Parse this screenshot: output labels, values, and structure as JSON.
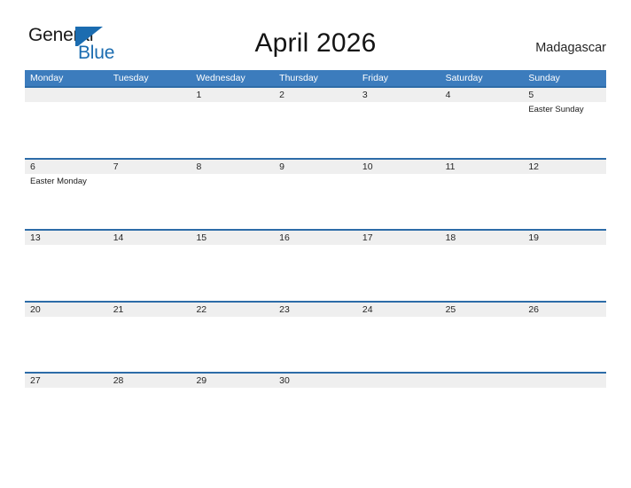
{
  "branding": {
    "logo_text_top": "General",
    "logo_text_bottom": "Blue",
    "logo_mark_name": "general-blue-triangle-logo",
    "logo_color": "#1b6cb0"
  },
  "header": {
    "title": "April 2026",
    "country": "Madagascar"
  },
  "theme": {
    "header_blue": "#3c7cbd",
    "row_rule_blue": "#2d6ca8",
    "band_gray": "#efefef",
    "page_background": "#ffffff",
    "text_dark": "#262626"
  },
  "calendar": {
    "month": "April",
    "year": "2026",
    "weekday_headers": [
      "Monday",
      "Tuesday",
      "Wednesday",
      "Thursday",
      "Friday",
      "Saturday",
      "Sunday"
    ],
    "weeks": [
      {
        "days": [
          {
            "num": "",
            "event": ""
          },
          {
            "num": "",
            "event": ""
          },
          {
            "num": "1",
            "event": ""
          },
          {
            "num": "2",
            "event": ""
          },
          {
            "num": "3",
            "event": ""
          },
          {
            "num": "4",
            "event": ""
          },
          {
            "num": "5",
            "event": "Easter Sunday"
          }
        ]
      },
      {
        "days": [
          {
            "num": "6",
            "event": "Easter Monday"
          },
          {
            "num": "7",
            "event": ""
          },
          {
            "num": "8",
            "event": ""
          },
          {
            "num": "9",
            "event": ""
          },
          {
            "num": "10",
            "event": ""
          },
          {
            "num": "11",
            "event": ""
          },
          {
            "num": "12",
            "event": ""
          }
        ]
      },
      {
        "days": [
          {
            "num": "13",
            "event": ""
          },
          {
            "num": "14",
            "event": ""
          },
          {
            "num": "15",
            "event": ""
          },
          {
            "num": "16",
            "event": ""
          },
          {
            "num": "17",
            "event": ""
          },
          {
            "num": "18",
            "event": ""
          },
          {
            "num": "19",
            "event": ""
          }
        ]
      },
      {
        "days": [
          {
            "num": "20",
            "event": ""
          },
          {
            "num": "21",
            "event": ""
          },
          {
            "num": "22",
            "event": ""
          },
          {
            "num": "23",
            "event": ""
          },
          {
            "num": "24",
            "event": ""
          },
          {
            "num": "25",
            "event": ""
          },
          {
            "num": "26",
            "event": ""
          }
        ]
      },
      {
        "days": [
          {
            "num": "27",
            "event": ""
          },
          {
            "num": "28",
            "event": ""
          },
          {
            "num": "29",
            "event": ""
          },
          {
            "num": "30",
            "event": ""
          },
          {
            "num": "",
            "event": ""
          },
          {
            "num": "",
            "event": ""
          },
          {
            "num": "",
            "event": ""
          }
        ]
      }
    ]
  }
}
